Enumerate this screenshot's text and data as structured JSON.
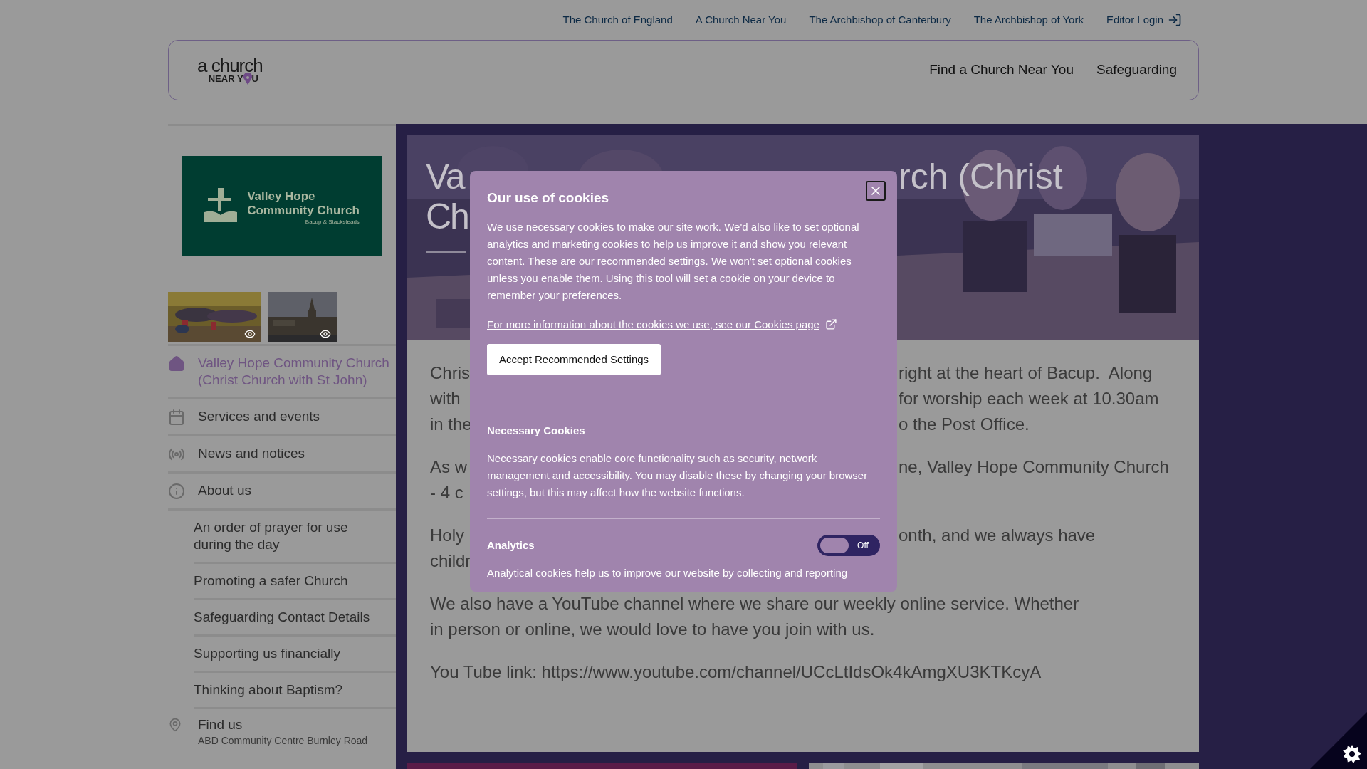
{
  "top_links": [
    "The Church of England",
    "A Church Near You",
    "The Archbishop of Canterbury",
    "The Archbishop of York"
  ],
  "editor_login": "Editor Login",
  "logo": {
    "line1": "a church",
    "line2_start": "NEAR Y",
    "line2_end": "U"
  },
  "main_nav": [
    "Find a Church Near You",
    "Safeguarding"
  ],
  "church_logo": {
    "name_line1": "Valley Hope",
    "name_line2": "Community Church",
    "place": "Bacup & Stacksteads"
  },
  "gallery": [
    {
      "kind": "picture"
    },
    {
      "kind": "picture"
    }
  ],
  "sidebar": {
    "items": [
      {
        "label": "Valley Hope Community Church (Christ Church with St John)",
        "selected": true
      },
      {
        "label": "Services and events",
        "selected": false
      },
      {
        "label": "News and notices",
        "selected": false
      },
      {
        "label": "About us",
        "selected": false,
        "children": [
          {
            "label": "An order of prayer for use during the day",
            "selected": false
          },
          {
            "label": "Promoting a safer Church",
            "selected": false
          },
          {
            "label": "Safeguarding Contact Details",
            "selected": false
          },
          {
            "label": "Supporting us financially",
            "selected": false
          },
          {
            "label": "Thinking about Baptism?",
            "selected": false
          }
        ]
      }
    ],
    "find_us": {
      "label": "Find us",
      "address": "ABD Community Centre Burnley Road"
    }
  },
  "page": {
    "title_left": [
      "Va",
      "Ch"
    ],
    "title_right": "rch (Christ",
    "covered_paragraphs": [
      {
        "lines": [
          {
            "left": "Chris",
            "right": "right at the heart of Bacup.  Along"
          },
          {
            "left": "with",
            "right": "for worship each week at 10.30am"
          },
          {
            "left": "in the",
            "right": "o the Post Office."
          }
        ]
      },
      {
        "lines": [
          {
            "left": "As w",
            "right": "ne, Valley Hope Community Church"
          },
          {
            "left": "- 4 c"
          }
        ]
      },
      {
        "lines": [
          {
            "left": "Holy",
            "right": "onth, and we always have"
          },
          {
            "left": "childr"
          }
        ]
      }
    ],
    "paragraphs": [
      "We also have a YouTube channel where we share our weekly online service. Whether in person or online, we would love to have you join with us.",
      "You Tube link: https://www.youtube.com/channel/UCcLtIdsOk4kAmgXU3KTKcyA"
    ]
  },
  "cookie_dialog": {
    "title": "Our use of cookies",
    "intro": "We use necessary cookies to make our site work. We'd also like to set optional analytics and marketing cookies to help us improve it and show you relevant content. These are our recommended settings. We won't set optional cookies unless you enable them. Using this tool will set a cookie on your device to remember your preferences.",
    "link": "For more information about the cookies we use, see our Cookies page",
    "accept_button": "Accept Recommended Settings",
    "sections": [
      {
        "kind": "info",
        "title": "Necessary Cookies",
        "text": "Necessary cookies enable core functionality such as security, network management and accessibility. You may disable these by changing your browser settings, but this may affect how the website functions."
      },
      {
        "kind": "toggle",
        "title": "Analytics",
        "on": false,
        "state_label": "Off",
        "text": "Analytical cookies help us to improve our website by collecting and reporting"
      }
    ]
  }
}
